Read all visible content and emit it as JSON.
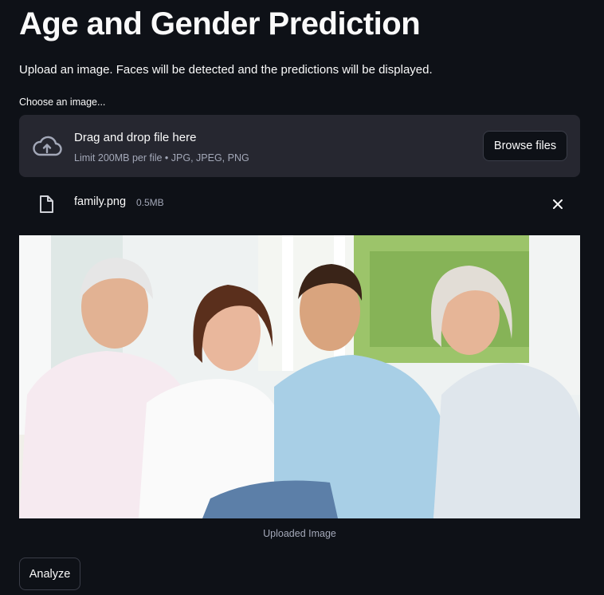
{
  "page": {
    "title": "Age and Gender Prediction",
    "subtitle": "Upload an image. Faces will be detected and the predictions will be displayed."
  },
  "uploader": {
    "label": "Choose an image...",
    "drag_text": "Drag and drop file here",
    "limit_text": "Limit 200MB per file • JPG, JPEG, PNG",
    "browse_label": "Browse files",
    "icon": "cloud-upload-icon"
  },
  "uploaded_file": {
    "name": "family.png",
    "size": "0.5MB",
    "icon": "file-icon",
    "remove_icon": "close-icon"
  },
  "image": {
    "caption": "Uploaded Image"
  },
  "actions": {
    "analyze_label": "Analyze"
  },
  "colors": {
    "background": "#0e1117",
    "panel": "#262730",
    "text": "#fafafa",
    "muted_text": "#a3a8b8",
    "button_border": "#3a3d48"
  }
}
